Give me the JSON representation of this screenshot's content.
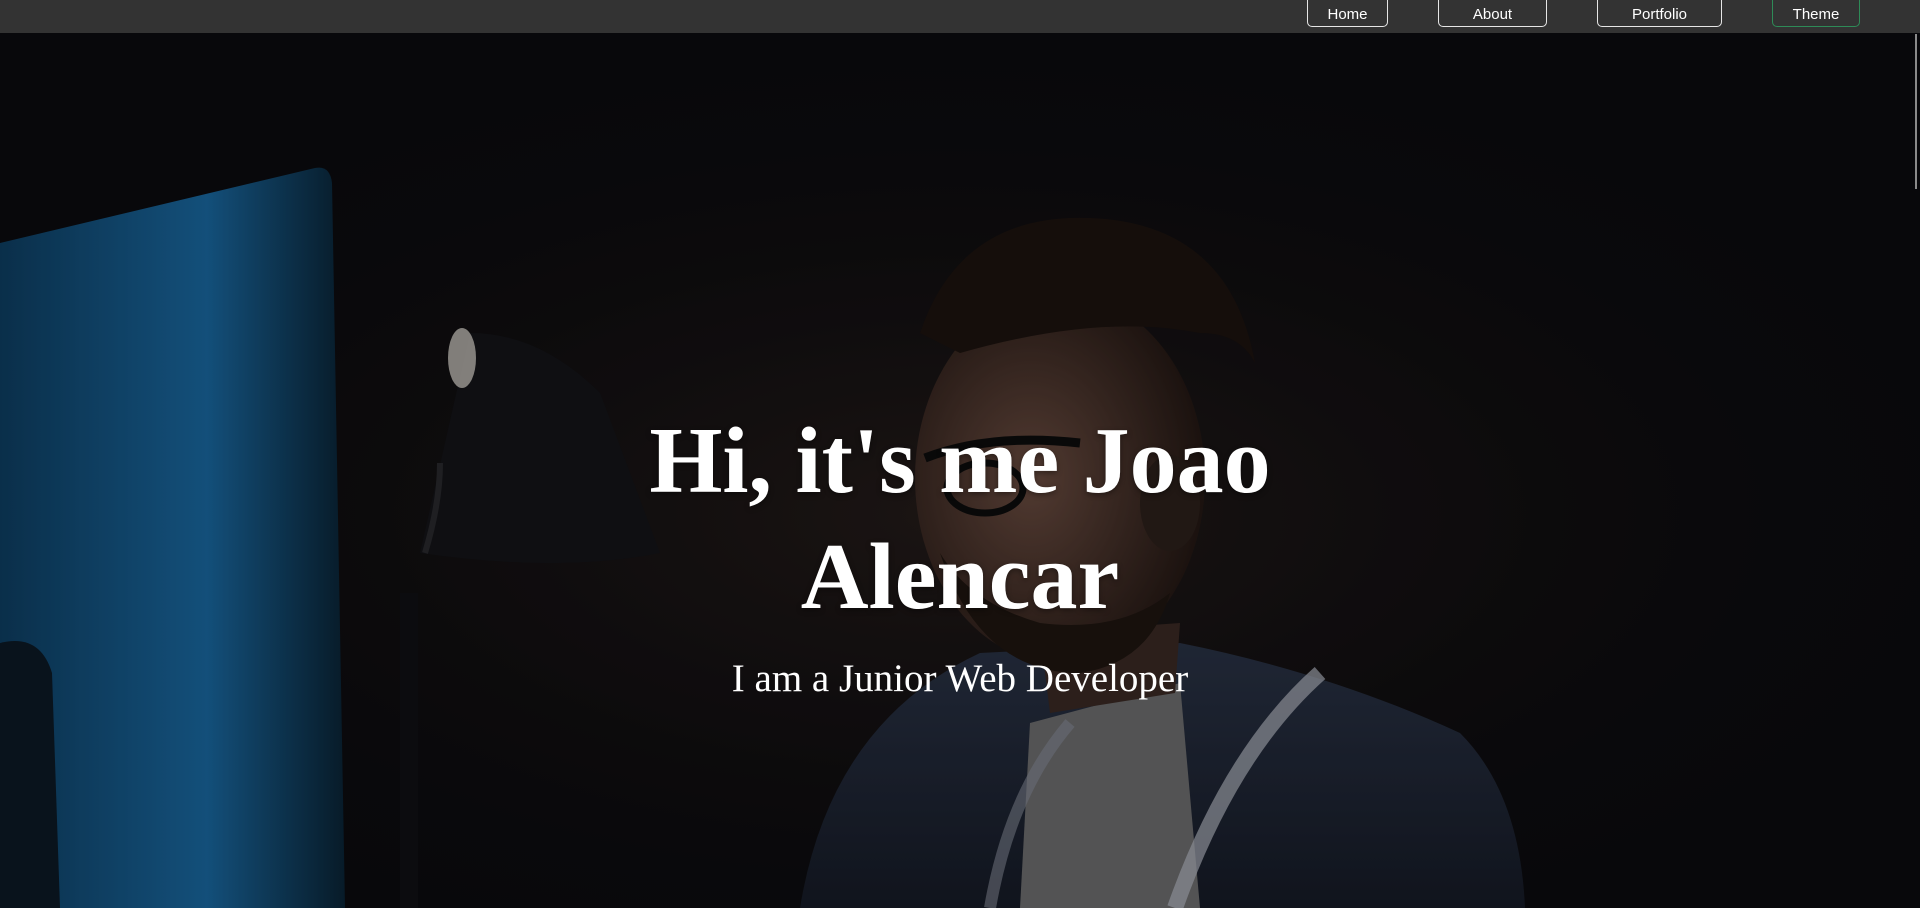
{
  "nav": {
    "home_label": "Home",
    "about_label": "About",
    "portfolio_label": "Portfolio",
    "theme_label": "Theme"
  },
  "hero": {
    "title": "Hi, it's me Joao Alencar",
    "subtitle": "I am a Junior Web Developer",
    "background_image": "man-with-glasses-at-computer-in-dark-room"
  },
  "colors": {
    "navbar_bg": "#333333",
    "theme_button_border": "#2e8b57",
    "text": "#ffffff",
    "monitor_glow": "#1e6ea8"
  }
}
